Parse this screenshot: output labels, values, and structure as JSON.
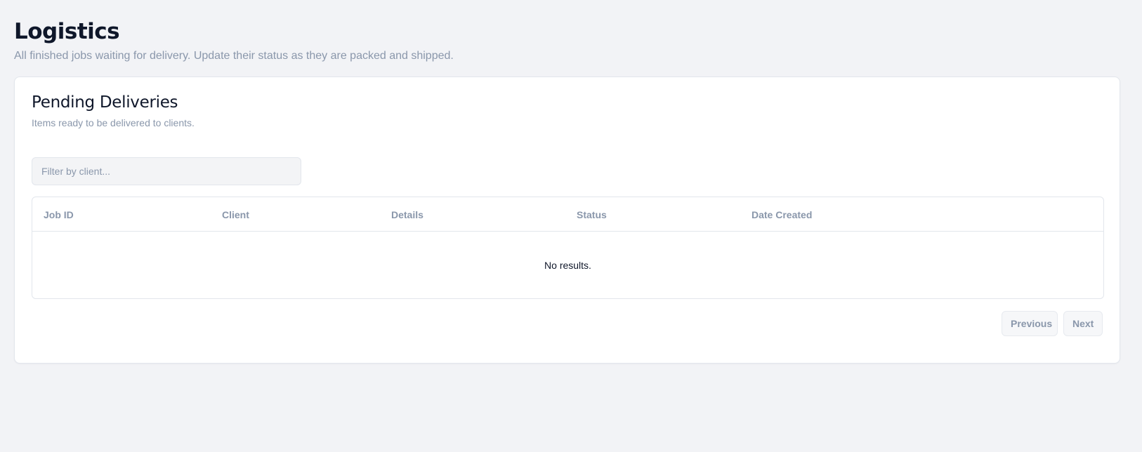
{
  "header": {
    "title": "Logistics",
    "subtitle": "All finished jobs waiting for delivery. Update their status as they are packed and shipped."
  },
  "card": {
    "title": "Pending Deliveries",
    "subtitle": "Items ready to be delivered to clients."
  },
  "filter": {
    "placeholder": "Filter by client...",
    "value": ""
  },
  "table": {
    "columns": [
      "Job ID",
      "Client",
      "Details",
      "Status",
      "Date Created"
    ],
    "rows": [],
    "empty_text": "No results."
  },
  "pagination": {
    "previous_label": "Previous",
    "next_label": "Next"
  }
}
